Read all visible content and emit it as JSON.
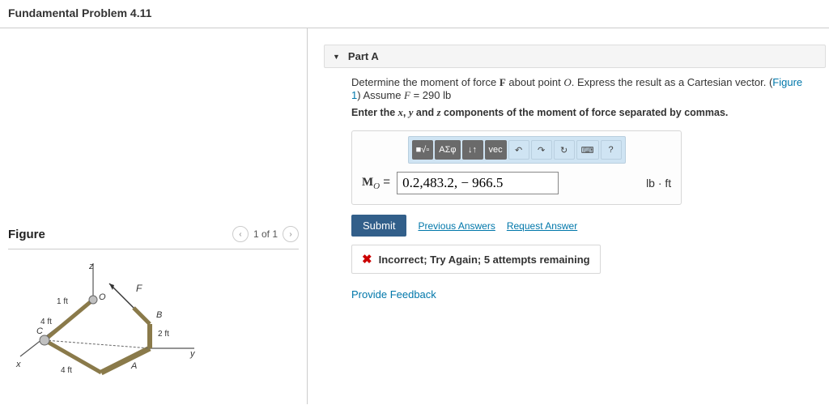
{
  "title": "Fundamental Problem 4.11",
  "figure": {
    "heading": "Figure",
    "pager": "1 of 1",
    "labels": {
      "z": "z",
      "x": "x",
      "y": "y",
      "O": "O",
      "A": "A",
      "B": "B",
      "C": "C",
      "F": "F",
      "d1": "1 ft",
      "d2": "4 ft",
      "d3": "4 ft",
      "d4": "2 ft"
    }
  },
  "part": {
    "name": "Part A",
    "prompt_pre": "Determine the moment of force ",
    "F": "F",
    "prompt_mid": " about point ",
    "O": "O",
    "prompt_post1": ". Express the result as a Cartesian vector. (",
    "fig_link": "Figure 1",
    "prompt_post2": ") Assume ",
    "Fvar": "F",
    "eq": " = 290 lb",
    "enter_pre": "Enter the ",
    "xv": "x",
    "yv": "y",
    "zv": "z",
    "enter_post": " components of the moment of force separated by commas.",
    "toolbar": {
      "t1": "■√▫",
      "t2": "ΑΣφ",
      "t3": "↓↑",
      "t4": "vec",
      "t5": "↶",
      "t6": "↷",
      "t7": "↻",
      "t8": "⌨",
      "t9": "?"
    },
    "answer_label_M": "M",
    "answer_label_sub": "O",
    "answer_eq": " = ",
    "answer_value": "0.2,483.2, − 966.5",
    "units": "lb · ft",
    "submit": "Submit",
    "prev": "Previous Answers",
    "request": "Request Answer",
    "feedback_msg": "Incorrect; Try Again; 5 attempts remaining",
    "provide": "Provide Feedback"
  }
}
